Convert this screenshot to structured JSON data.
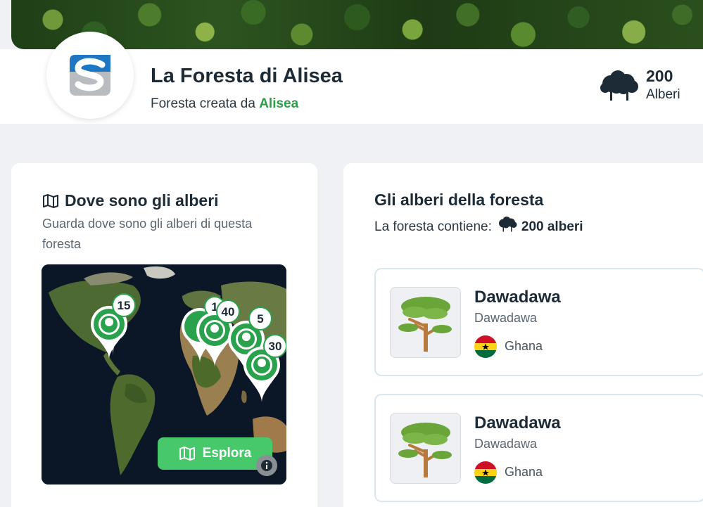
{
  "forest": {
    "title": "La Foresta di Alisea",
    "subtitle_prefix": "Foresta creata da",
    "creator": "Alisea",
    "tree_count": "200",
    "tree_count_label": "Alberi"
  },
  "map_section": {
    "title": "Dove sono gli alberi",
    "description": "Guarda dove sono gli alberi di questa foresta",
    "pins": [
      "15",
      "1",
      "40",
      "5",
      "30"
    ],
    "explore_label": "Esplora"
  },
  "trees_section": {
    "title": "Gli alberi della foresta",
    "contains_prefix": "La foresta contiene:",
    "contains_count": "200 alberi",
    "trees": [
      {
        "name": "Dawadawa",
        "scientific": "Dawadawa",
        "country": "Ghana"
      },
      {
        "name": "Dawadawa",
        "scientific": "Dawadawa",
        "country": "Ghana"
      }
    ]
  },
  "colors": {
    "brand_green": "#46c86b",
    "creator_green": "#2e9d4a",
    "text_dark": "#1d2b36",
    "page_bg": "#eff1f4"
  }
}
